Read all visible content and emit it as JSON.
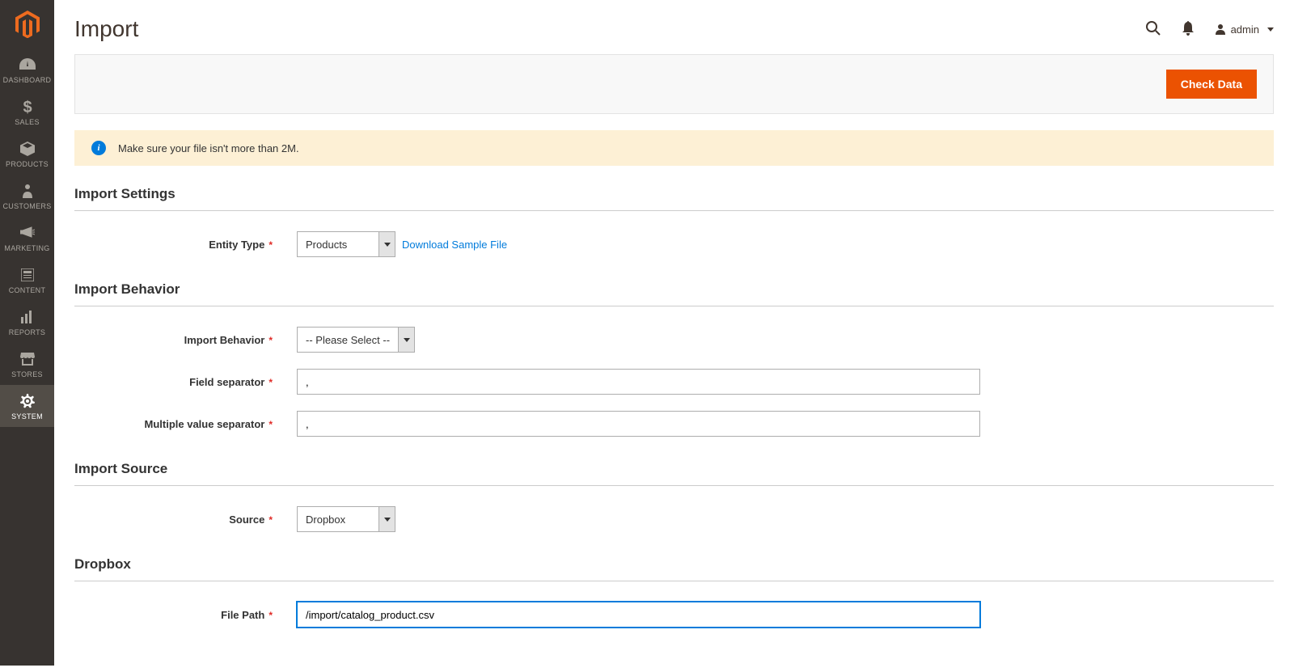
{
  "sidebar": {
    "items": [
      {
        "label": "Dashboard"
      },
      {
        "label": "Sales"
      },
      {
        "label": "Products"
      },
      {
        "label": "Customers"
      },
      {
        "label": "Marketing"
      },
      {
        "label": "Content"
      },
      {
        "label": "Reports"
      },
      {
        "label": "Stores"
      },
      {
        "label": "System"
      }
    ]
  },
  "header": {
    "title": "Import",
    "user": "admin"
  },
  "action": {
    "check_data": "Check Data"
  },
  "message": {
    "file_size": "Make sure your file isn't more than 2M."
  },
  "sections": {
    "import_settings": "Import Settings",
    "import_behavior": "Import Behavior",
    "import_source": "Import Source",
    "dropbox": "Dropbox"
  },
  "fields": {
    "entity_type": {
      "label": "Entity Type",
      "value": "Products"
    },
    "download_sample": "Download Sample File",
    "import_behavior": {
      "label": "Import Behavior",
      "value": "-- Please Select --"
    },
    "field_separator": {
      "label": "Field separator",
      "value": ","
    },
    "multiple_value_separator": {
      "label": "Multiple value separator",
      "value": ","
    },
    "source": {
      "label": "Source",
      "value": "Dropbox"
    },
    "file_path": {
      "label": "File Path",
      "value": "/import/catalog_product.csv"
    }
  }
}
